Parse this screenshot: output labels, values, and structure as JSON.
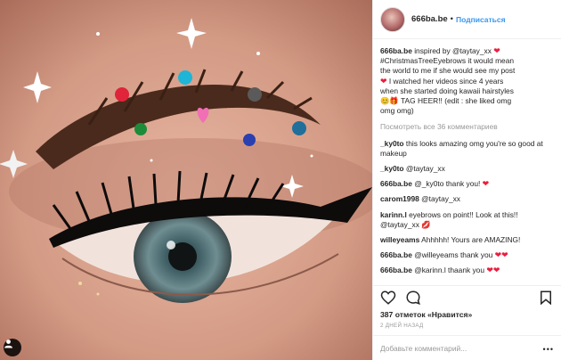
{
  "header": {
    "username": "666ba.be",
    "separator": "•",
    "follow_label": "Подписаться"
  },
  "caption": {
    "username": "666ba.be",
    "lines": [
      "inspired by @taytay_xx",
      "#ChristmasTreeEyebrows it would mean",
      "the world to me if she would see my post",
      "I watched her videos since 4 years",
      "when she started doing kawaii hairstyles",
      "TAG HEER!! (edit : she liked omg",
      "omg omg)"
    ]
  },
  "view_all_label": "Посмотреть все 36 комментариев",
  "comments": [
    {
      "user": "_ky0to",
      "text": "this looks amazing omg you're so good at makeup",
      "emoji": ""
    },
    {
      "user": "_ky0to",
      "text": "@taytay_xx",
      "emoji": ""
    },
    {
      "user": "666ba.be",
      "text": "@_ky0to thank you!",
      "emoji": "❤"
    },
    {
      "user": "carom1998",
      "text": "@taytay_xx",
      "emoji": ""
    },
    {
      "user": "karinn.l",
      "text": "eyebrows on point!! Look at this!! @taytay_xx",
      "emoji": "💋"
    },
    {
      "user": "willeyeams",
      "text": "Ahhhhh! Yours are AMAZING!",
      "emoji": ""
    },
    {
      "user": "666ba.be",
      "text": "@willeyeams thank you",
      "emoji": "❤❤"
    },
    {
      "user": "666ba.be",
      "text": "@karinn.l thaank you",
      "emoji": "❤❤"
    }
  ],
  "likes_label": "387 отметок «Нравится»",
  "timestamp": "2 ДНЕЙ НАЗАД",
  "add_comment_placeholder": "Добавьте комментарий...",
  "more_label": "•••",
  "colors": {
    "link": "#3897f0",
    "heart": "#ed1c3d",
    "muted": "#999999"
  }
}
